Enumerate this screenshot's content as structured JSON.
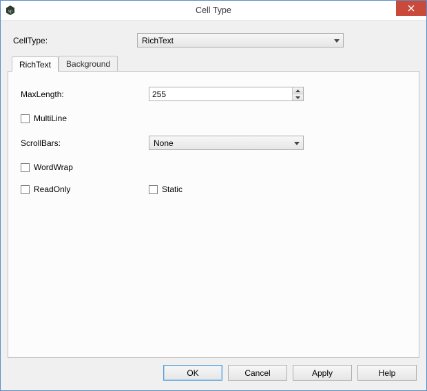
{
  "window": {
    "title": "Cell Type"
  },
  "top": {
    "cellTypeLabel": "CellType:",
    "cellTypeValue": "RichText"
  },
  "tabs": {
    "richtext": "RichText",
    "background": "Background",
    "active": "richtext"
  },
  "fields": {
    "maxLengthLabel": "MaxLength:",
    "maxLengthValue": "255",
    "multiLineLabel": "MultiLine",
    "multiLineChecked": false,
    "scrollBarsLabel": "ScrollBars:",
    "scrollBarsValue": "None",
    "wordWrapLabel": "WordWrap",
    "wordWrapChecked": false,
    "readOnlyLabel": "ReadOnly",
    "readOnlyChecked": false,
    "staticLabel": "Static",
    "staticChecked": false
  },
  "buttons": {
    "ok": "OK",
    "cancel": "Cancel",
    "apply": "Apply",
    "help": "Help"
  }
}
